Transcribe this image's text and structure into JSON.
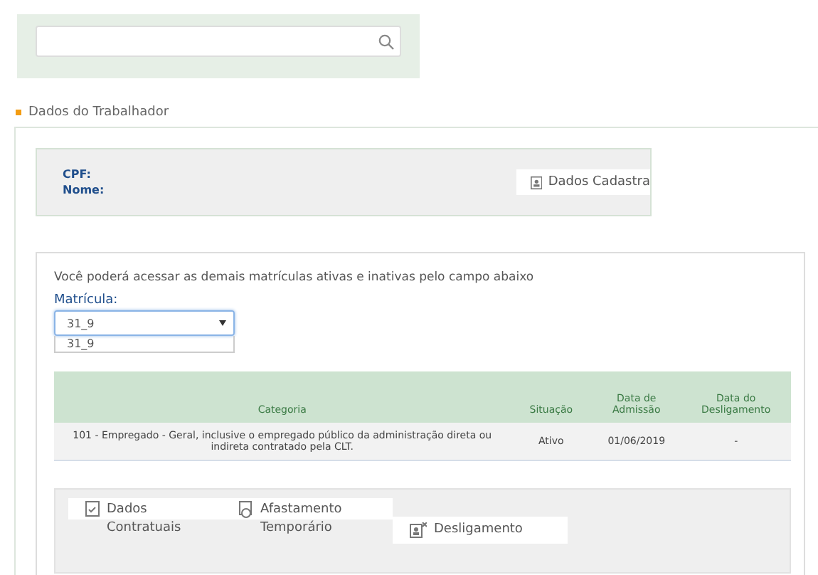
{
  "section": {
    "title": "Dados do Trabalhador"
  },
  "worker": {
    "fields": [
      {
        "label": "CPF:"
      },
      {
        "label": "Nome:"
      }
    ],
    "button": "Dados Cadastra"
  },
  "enrollment": {
    "hint": "Você poderá acessar as demais matrículas ativas e inativas pelo campo abaixo",
    "label": "Matrícula:",
    "value": "31_9",
    "options": [
      "31_9"
    ]
  },
  "table": {
    "columns": [
      "Categoria",
      "Situação",
      "Data de Admissão",
      "Data do Desligamento"
    ],
    "rows": [
      [
        "101 - Empregado - Geral, inclusive o empregado público da administração direta ou indireta contratado pela CLT.",
        "Ativo",
        "01/06/2019",
        "-"
      ]
    ]
  },
  "tabs": [
    {
      "label": "Dados Contratuais",
      "kind": "contract"
    },
    {
      "label": "Afastamento Temporário",
      "kind": "leave"
    },
    {
      "label": "Desligamento",
      "kind": "dismissal"
    }
  ]
}
